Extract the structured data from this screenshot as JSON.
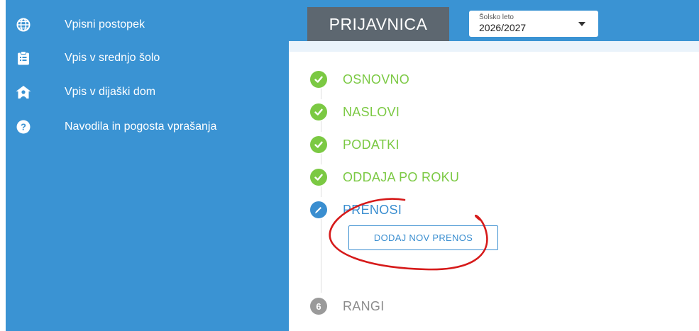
{
  "sidebar": {
    "items": [
      {
        "label": "Vpisni postopek",
        "icon": "globe-icon"
      },
      {
        "label": "Vpis v srednjo šolo",
        "icon": "clipboard-icon"
      },
      {
        "label": "Vpis v dijaški dom",
        "icon": "home-user-icon"
      },
      {
        "label": "Navodila in pogosta vprašanja",
        "icon": "help-icon"
      }
    ]
  },
  "header": {
    "title": "PRIJAVNICA",
    "year_select": {
      "caption": "Šolsko leto",
      "value": "2026/2027"
    }
  },
  "steps": [
    {
      "label": "OSNOVNO",
      "status": "done"
    },
    {
      "label": "NASLOVI",
      "status": "done"
    },
    {
      "label": "PODATKI",
      "status": "done"
    },
    {
      "label": "ODDAJA PO ROKU",
      "status": "done"
    },
    {
      "label": "PRENOSI",
      "status": "active"
    },
    {
      "label": "RANGI",
      "status": "pending",
      "number": "6"
    }
  ],
  "transfer": {
    "add_button": "DODAJ NOV PRENOS"
  },
  "colors": {
    "sidebar_bg": "#3a93d3",
    "done": "#7bc943",
    "active": "#3a8ed0",
    "pending": "#9a9a9a",
    "annotation": "#d61a1a"
  }
}
